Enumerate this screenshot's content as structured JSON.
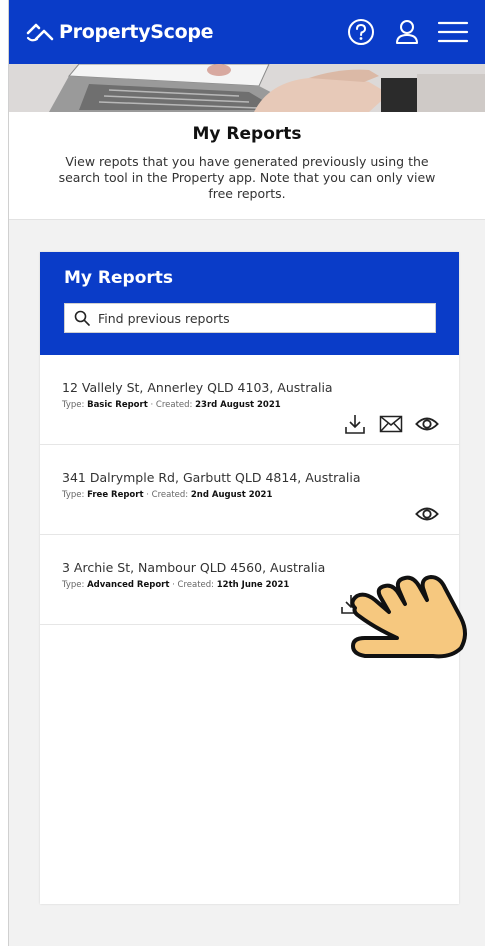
{
  "header": {
    "brand": "PropertyScope",
    "brand_color": "#0a3cc8",
    "icons": [
      "help-icon",
      "user-icon",
      "menu-icon"
    ]
  },
  "intro": {
    "title": "My Reports",
    "description": "View repots that you have generated previously using the search tool in the Property app. Note that you can only view free reports."
  },
  "panel": {
    "title": "My Reports",
    "search_placeholder": "Find previous reports"
  },
  "reports": [
    {
      "address": "12 Vallely St, Annerley QLD 4103, Australia",
      "type_label": "Type:",
      "type": "Basic Report",
      "created_label": "· Created:",
      "created": "23rd August 2021",
      "actions": [
        "download-icon",
        "email-icon",
        "view-icon"
      ]
    },
    {
      "address": "341 Dalrymple Rd, Garbutt QLD 4814, Australia",
      "type_label": "Type:",
      "type": "Free Report",
      "created_label": "· Created:",
      "created": "2nd August 2021",
      "actions": [
        "view-icon"
      ]
    },
    {
      "address": "3 Archie St, Nambour QLD 4560, Australia",
      "type_label": "Type:",
      "type": "Advanced Report",
      "created_label": "· Created:",
      "created": "12th June 2021",
      "actions": [
        "download-icon"
      ]
    }
  ]
}
